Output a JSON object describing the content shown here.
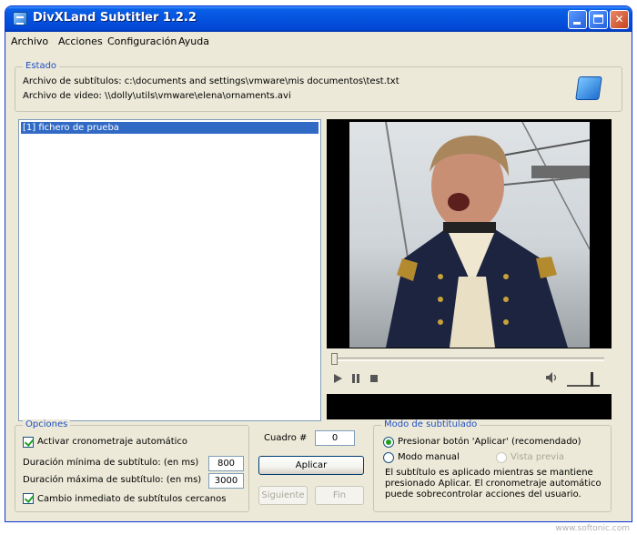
{
  "window": {
    "title": "DivXLand Subtitler 1.2.2"
  },
  "menu": {
    "items": [
      "Archivo",
      "Acciones",
      "Configuración",
      "Ayuda"
    ]
  },
  "estado": {
    "legend": "Estado",
    "subtitle_file": "Archivo de subtítulos: c:\\documents and settings\\vmware\\mis documentos\\test.txt",
    "video_file": "Archivo de video: \\\\dolly\\utils\\vmware\\elena\\ornaments.avi"
  },
  "subtitle_list": {
    "items": [
      "[1] fichero de prueba"
    ]
  },
  "opciones": {
    "legend": "Opciones",
    "auto_timing": {
      "label": "Activar cronometraje automático",
      "checked": true
    },
    "min_duration": {
      "label": "Duración mínima de subtítulo: (en ms)",
      "value": "800"
    },
    "max_duration": {
      "label": "Duración máxima de subtítulo: (en ms)",
      "value": "3000"
    },
    "immediate_change": {
      "label": "Cambio inmediato de subtítulos cercanos",
      "checked": true
    }
  },
  "actions": {
    "cuadro_label": "Cuadro #",
    "cuadro_value": "0",
    "apply_label": "Aplicar",
    "next_label": "Siguiente",
    "end_label": "Fin"
  },
  "modo": {
    "legend": "Modo de subtitulado",
    "press_apply": "Presionar botón 'Aplicar' (recomendado)",
    "manual": "Modo manual",
    "preview": "Vista previa",
    "description": "El subtítulo es aplicado mientras se mantiene presionado Aplicar. El cronometraje automático puede sobrecontrolar acciones del usuario."
  },
  "watermark": "www.softonic.com",
  "colors": {
    "titlebar": "#0453de",
    "window_bg": "#ece9d8",
    "selection": "#316ac5",
    "legend_text": "#1f4fc4"
  }
}
